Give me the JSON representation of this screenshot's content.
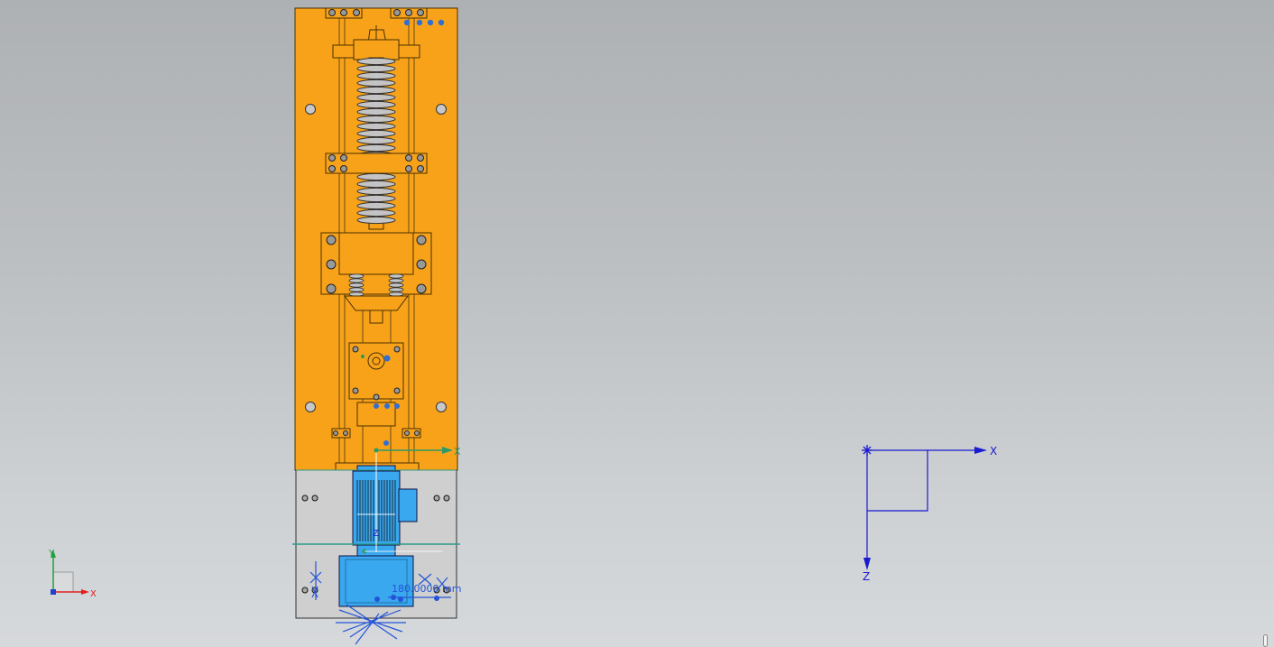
{
  "colors": {
    "plate": "#f8a21a",
    "plate_stroke": "#4a3000",
    "steel": "#b8b8b8",
    "motor_blue": "#3aa8ee",
    "annotation_blue": "#2454d6",
    "axis_blue": "#1a1ad0",
    "axis_green": "#2a9a6a",
    "triad_red": "#e02020",
    "triad_green": "#20a040"
  },
  "icons": {
    "view_triad": "xyz-triad-icon",
    "wcs_axes": "wcs-axis-icon",
    "origin_marker": "origin-star-icon"
  },
  "model": {
    "dimension_label": "180.0000 mm",
    "csys_axis_x": "X",
    "csys_axis_z": "Z"
  },
  "wcs": {
    "x_label": "X",
    "z_label": "Z"
  },
  "triad": {
    "x_label": "X",
    "y_label": "Y"
  }
}
